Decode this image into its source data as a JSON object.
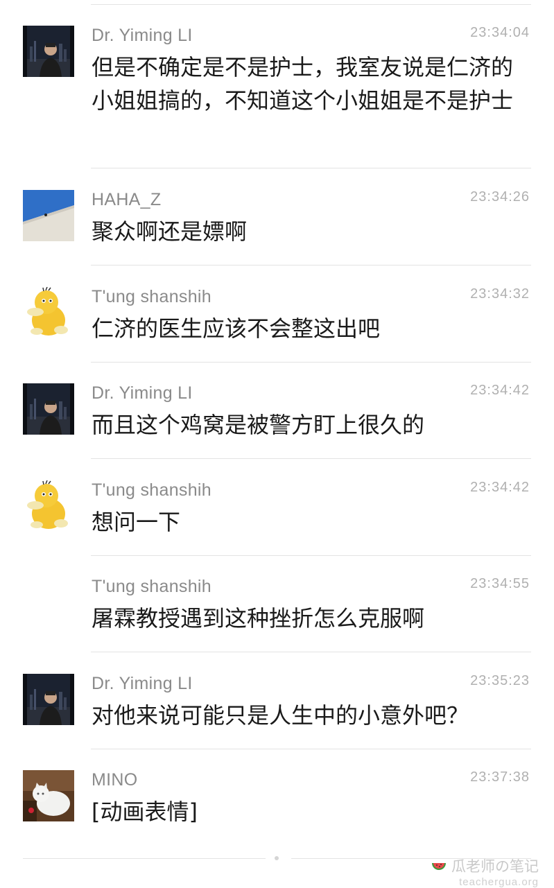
{
  "messages": [
    {
      "sender": "Dr. Yiming LI",
      "time": "23:34:04",
      "text": "但是不确定是不是护士，我室友说是仁济的小姐姐搞的，不知道这个小姐姐是不是护士",
      "avatar": "city-night-portrait"
    },
    {
      "sender": "HAHA_Z",
      "time": "23:34:26",
      "text": "聚众啊还是嫖啊",
      "avatar": "blue-sky-wall"
    },
    {
      "sender": "T'ung shanshih",
      "time": "23:34:32",
      "text": "仁济的医生应该不会整这出吧",
      "avatar": "yellow-duck"
    },
    {
      "sender": "Dr. Yiming LI",
      "time": "23:34:42",
      "text": "而且这个鸡窝是被警方盯上很久的",
      "avatar": "city-night-portrait"
    },
    {
      "sender": "T'ung shanshih",
      "time": "23:34:42",
      "text": "想问一下",
      "avatar": "yellow-duck"
    },
    {
      "sender": "T'ung shanshih",
      "time": "23:34:55",
      "text": "屠霖教授遇到这种挫折怎么克服啊",
      "avatar": "none"
    },
    {
      "sender": "Dr. Yiming LI",
      "time": "23:35:23",
      "text": "对他来说可能只是人生中的小意外吧？",
      "avatar": "city-night-portrait"
    },
    {
      "sender": "MINO",
      "time": "23:37:38",
      "text": "[动画表情]",
      "avatar": "white-cat"
    }
  ],
  "watermark": {
    "title": "瓜老师の笔记",
    "url": "teachergua.org"
  }
}
